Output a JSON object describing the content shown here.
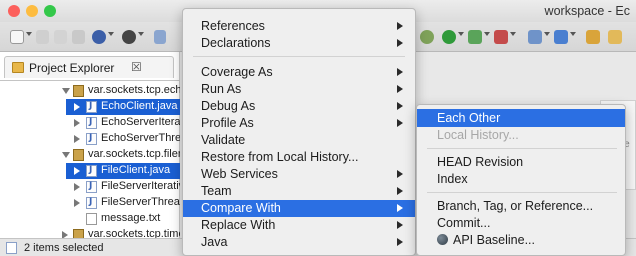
{
  "window": {
    "title": "workspace - Ec",
    "traffic_lights": [
      "#fc605c",
      "#fdbc40",
      "#34c84a"
    ]
  },
  "toolbar": {
    "icons": [
      "new-icon",
      "save-icon",
      "print-icon",
      "debug-icon",
      "run-icon",
      "search-icon",
      "run-green-icon",
      "external-tools-icon",
      "new-java-project-icon",
      "open-type-icon",
      "open-task-icon"
    ]
  },
  "project_explorer": {
    "tab_title": "Project Explorer",
    "close_glyph": "☒",
    "tree": [
      {
        "label": "var.sockets.tcp.echo",
        "kind": "package",
        "expanded": true,
        "selected": false
      },
      {
        "label": "EchoClient.java",
        "kind": "java",
        "selected": true
      },
      {
        "label": "EchoServerIterat",
        "kind": "java",
        "selected": false
      },
      {
        "label": "EchoServerThrea",
        "kind": "java",
        "selected": false
      },
      {
        "label": "var.sockets.tcp.filer",
        "kind": "package",
        "expanded": true,
        "selected": false
      },
      {
        "label": "FileClient.java",
        "kind": "java",
        "selected": true
      },
      {
        "label": "FileServerIterativ",
        "kind": "java",
        "selected": false
      },
      {
        "label": "FileServerThread.",
        "kind": "java",
        "selected": false
      },
      {
        "label": "message.txt",
        "kind": "text",
        "selected": false
      },
      {
        "label": "var.sockets.tcp.time",
        "kind": "package",
        "expanded": false,
        "selected": false
      }
    ]
  },
  "background_pane_text": "lore",
  "status_bar": {
    "text": "2 items selected"
  },
  "context_menu": {
    "items": [
      {
        "label": "References",
        "submenu": true
      },
      {
        "label": "Declarations",
        "submenu": true
      },
      {
        "separator": true
      },
      {
        "label": "Coverage As",
        "submenu": true
      },
      {
        "label": "Run As",
        "submenu": true
      },
      {
        "label": "Debug As",
        "submenu": true
      },
      {
        "label": "Profile As",
        "submenu": true
      },
      {
        "label": "Validate",
        "submenu": false
      },
      {
        "label": "Restore from Local History...",
        "submenu": false
      },
      {
        "label": "Web Services",
        "submenu": true
      },
      {
        "label": "Team",
        "submenu": true
      },
      {
        "label": "Compare With",
        "submenu": true,
        "highlighted": true
      },
      {
        "label": "Replace With",
        "submenu": true
      },
      {
        "label": "Java",
        "submenu": true
      }
    ]
  },
  "compare_with_submenu": {
    "items": [
      {
        "label": "Each Other",
        "highlighted": true
      },
      {
        "label": "Local History...",
        "disabled": true
      },
      {
        "separator": true
      },
      {
        "label": "HEAD Revision"
      },
      {
        "label": "Index"
      },
      {
        "separator": true
      },
      {
        "label": "Branch, Tag, or Reference..."
      },
      {
        "label": "Commit..."
      },
      {
        "label": "API Baseline...",
        "icon": "api-baseline-icon"
      }
    ]
  },
  "colors": {
    "menu_highlight": "#2b6fe3",
    "tree_selection": "#1a5fd3",
    "disabled_text": "#a7a7a7"
  }
}
